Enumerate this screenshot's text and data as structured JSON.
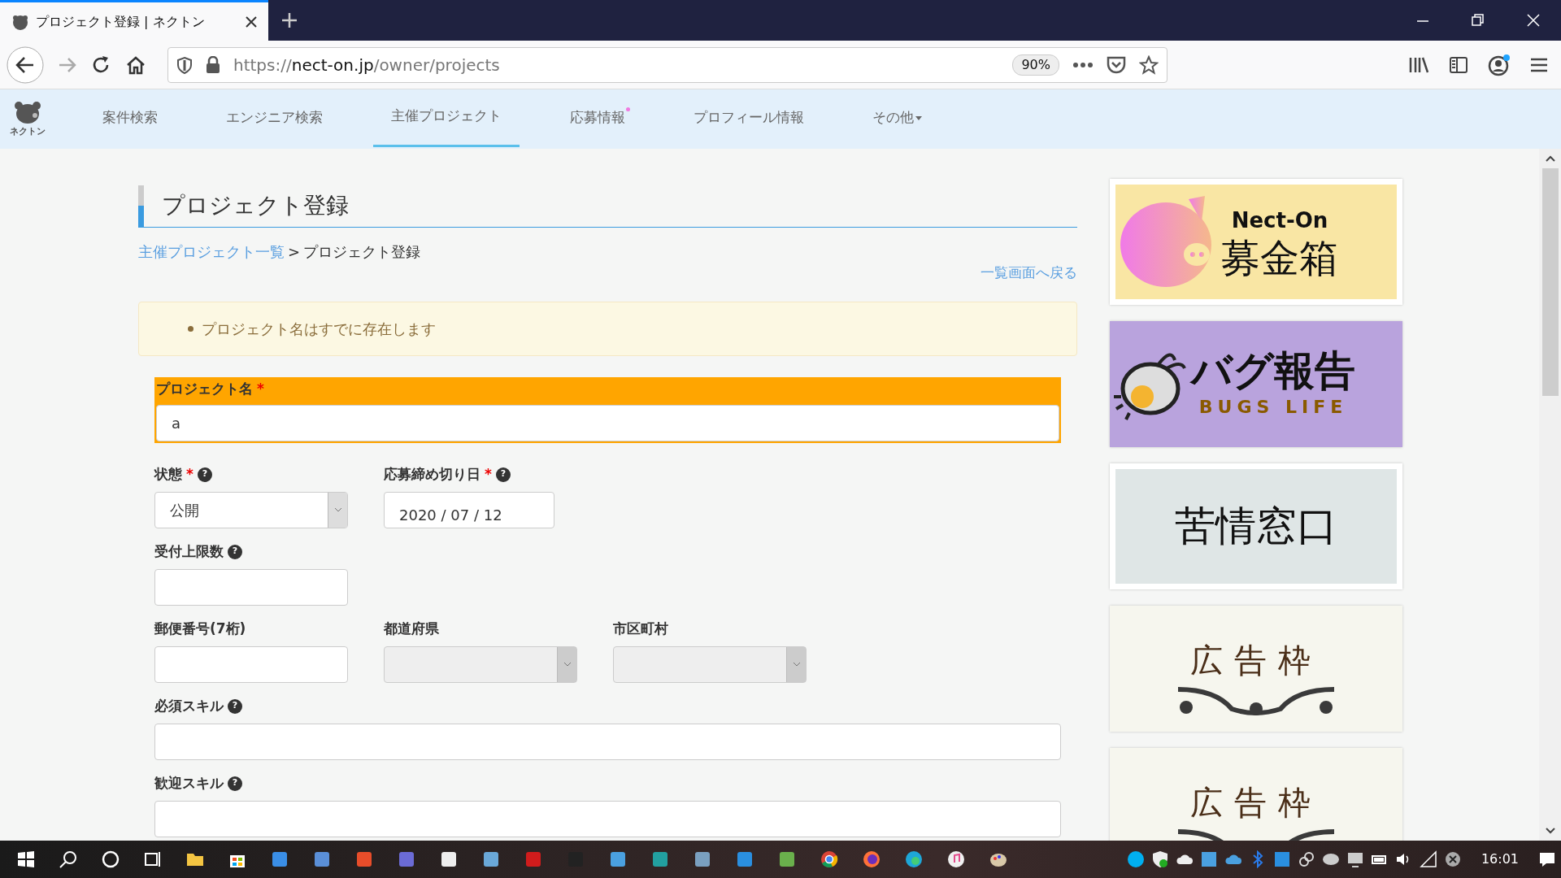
{
  "browser": {
    "tab_title": "プロジェクト登録 | ネクトン",
    "url_scheme": "https://",
    "url_domain": "nect-on.jp",
    "url_path": "/owner/projects",
    "zoom": "90%"
  },
  "nav": {
    "logo_text": "ネクトン",
    "items": [
      {
        "label": "案件検索",
        "selected": false,
        "notification": false,
        "dropdown": false
      },
      {
        "label": "エンジニア検索",
        "selected": false,
        "notification": false,
        "dropdown": false
      },
      {
        "label": "主催プロジェクト",
        "selected": true,
        "notification": false,
        "dropdown": false
      },
      {
        "label": "応募情報",
        "selected": false,
        "notification": true,
        "dropdown": false
      },
      {
        "label": "プロフィール情報",
        "selected": false,
        "notification": false,
        "dropdown": false
      },
      {
        "label": "その他",
        "selected": false,
        "notification": false,
        "dropdown": true
      }
    ]
  },
  "page": {
    "title": "プロジェクト登録",
    "breadcrumb": {
      "link": "主催プロジェクト一覧",
      "separator": ">",
      "current": "プロジェクト登録"
    },
    "back_link": "一覧画面へ戻る",
    "alert": {
      "messages": [
        "プロジェクト名はすでに存在します"
      ]
    },
    "form_rows": [
      [
        {
          "label": "プロジェクト名",
          "required_mark": "*",
          "kind": "text",
          "wide": true,
          "value": "a",
          "error": true,
          "disabled": false
        }
      ],
      [
        {
          "label": "状態",
          "required_mark": "*",
          "help": "?",
          "kind": "select",
          "wide": false,
          "value": "公開",
          "error": false,
          "disabled": false
        },
        {
          "label": "応募締め切り日",
          "required_mark": "*",
          "help": "?",
          "kind": "date",
          "wide": false,
          "value": "2020 / 07 / 12",
          "error": false,
          "disabled": false
        }
      ],
      [
        {
          "label": "受付上限数",
          "help": "?",
          "kind": "text",
          "wide": false,
          "error": false,
          "disabled": false
        }
      ],
      [
        {
          "label": "郵便番号(7桁)",
          "kind": "text",
          "wide": false,
          "error": false,
          "disabled": false
        },
        {
          "label": "都道府県",
          "kind": "select",
          "wide": false,
          "error": false,
          "disabled": true
        },
        {
          "label": "市区町村",
          "kind": "select",
          "wide": false,
          "error": false,
          "disabled": true
        }
      ],
      [
        {
          "label": "必須スキル",
          "help": "?",
          "kind": "text",
          "wide": true,
          "error": false,
          "disabled": false
        }
      ],
      [
        {
          "label": "歓迎スキル",
          "help": "?",
          "kind": "text",
          "wide": true,
          "error": false,
          "disabled": false
        }
      ]
    ]
  },
  "sidebar": {
    "banners": [
      {
        "kind": "donation",
        "brand": "Nect-On",
        "title": "募金箱"
      },
      {
        "kind": "bug",
        "title": "バグ報告",
        "subtitle": "BUGS LIFE"
      },
      {
        "kind": "complaint",
        "title": "苦情窓口"
      },
      {
        "kind": "ad",
        "title": "広告枠"
      },
      {
        "kind": "ad",
        "title": "広告枠"
      }
    ]
  },
  "taskbar": {
    "time": "16:01"
  }
}
